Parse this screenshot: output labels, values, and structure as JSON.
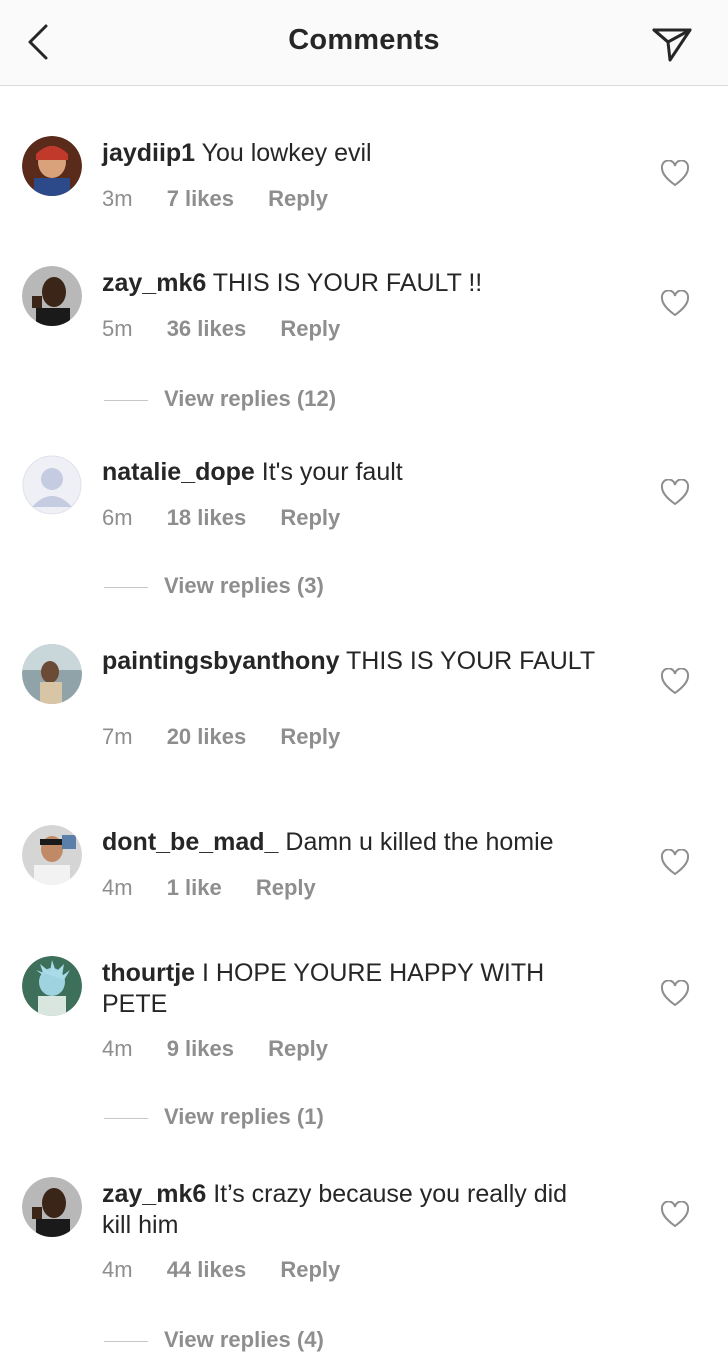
{
  "header": {
    "title": "Comments",
    "back_icon": "chevron-left-icon",
    "send_icon": "paper-plane-icon"
  },
  "comments": [
    {
      "username": "jaydiip1",
      "text": "You lowkey evil",
      "time": "3m",
      "likes": "7 likes",
      "reply": "Reply",
      "view_replies": ""
    },
    {
      "username": "zay_mk6",
      "text": "THIS IS YOUR FAULT !!",
      "time": "5m",
      "likes": "36 likes",
      "reply": "Reply",
      "view_replies": "View replies (12)"
    },
    {
      "username": "natalie_dope",
      "text": "It's your fault",
      "time": "6m",
      "likes": "18 likes",
      "reply": "Reply",
      "view_replies": "View replies (3)"
    },
    {
      "username": "paintingsbyanthony",
      "text": "THIS IS YOUR FAULT",
      "time": "7m",
      "likes": "20 likes",
      "reply": "Reply",
      "view_replies": ""
    },
    {
      "username": "dont_be_mad_",
      "text": "Damn u killed the homie",
      "time": "4m",
      "likes": "1 like",
      "reply": "Reply",
      "view_replies": ""
    },
    {
      "username": "thourtje",
      "text": "I HOPE YOURE HAPPY WITH PETE",
      "time": "4m",
      "likes": "9 likes",
      "reply": "Reply",
      "view_replies": "View replies (1)"
    },
    {
      "username": "zay_mk6",
      "text": "It’s crazy because you really did kill him",
      "time": "4m",
      "likes": "44 likes",
      "reply": "Reply",
      "view_replies": "View replies (4)"
    }
  ],
  "colors": {
    "text": "#262626",
    "secondary": "#8e8e8e",
    "divider": "#dbdbdb",
    "header_bg": "#fafafa"
  }
}
